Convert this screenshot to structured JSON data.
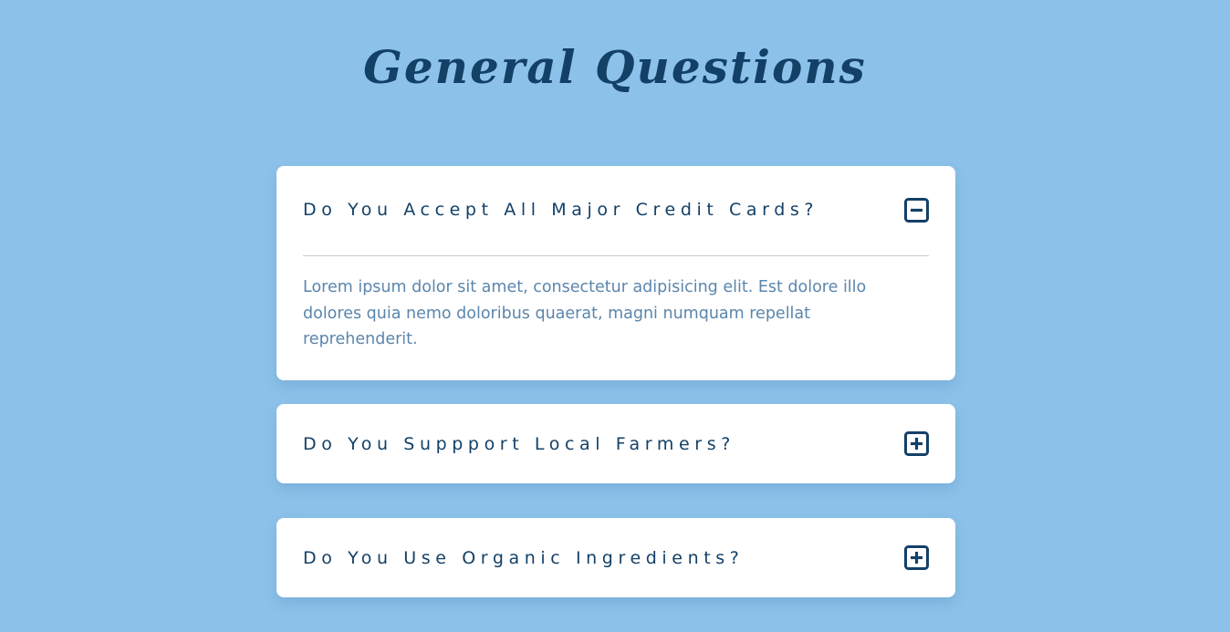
{
  "header": {
    "title": "General Questions"
  },
  "faqs": [
    {
      "question": "Do You Accept All Major Credit Cards?",
      "answer": "Lorem ipsum dolor sit amet, consectetur adipisicing elit. Est dolore illo dolores quia nemo doloribus quaerat, magni numquam repellat reprehenderit.",
      "state": "expanded",
      "icon": "minus-square-icon"
    },
    {
      "question": "Do You Suppport Local Farmers?",
      "state": "collapsed",
      "icon": "plus-square-icon"
    },
    {
      "question": "Do You Use Organic Ingredients?",
      "state": "collapsed",
      "icon": "plus-square-icon"
    }
  ],
  "colors": {
    "background": "#8cc2ea",
    "heading": "#134067",
    "answer_text": "#5b86ad",
    "card": "#ffffff"
  }
}
